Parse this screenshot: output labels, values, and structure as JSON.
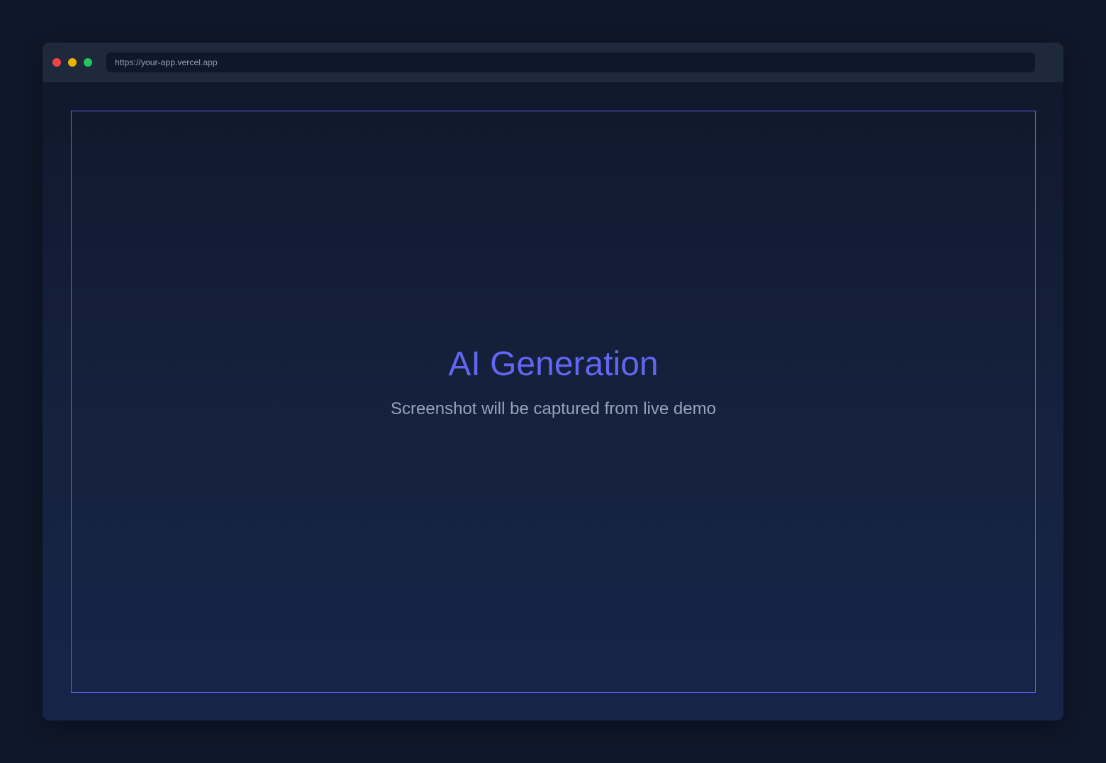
{
  "browser": {
    "url": "https://your-app.vercel.app"
  },
  "hero": {
    "title": "AI Generation",
    "subtitle": "Screenshot will be captured from live demo"
  },
  "colors": {
    "page_background": "#0f172a",
    "titlebar": "#1e293b",
    "accent": "#6366f1",
    "muted_text": "#94a3b8",
    "close": "#ef4444",
    "minimize": "#eab308",
    "maximize": "#22c55e"
  },
  "icons": {
    "close": "traffic-light-close-icon",
    "minimize": "traffic-light-minimize-icon",
    "maximize": "traffic-light-maximize-icon"
  }
}
